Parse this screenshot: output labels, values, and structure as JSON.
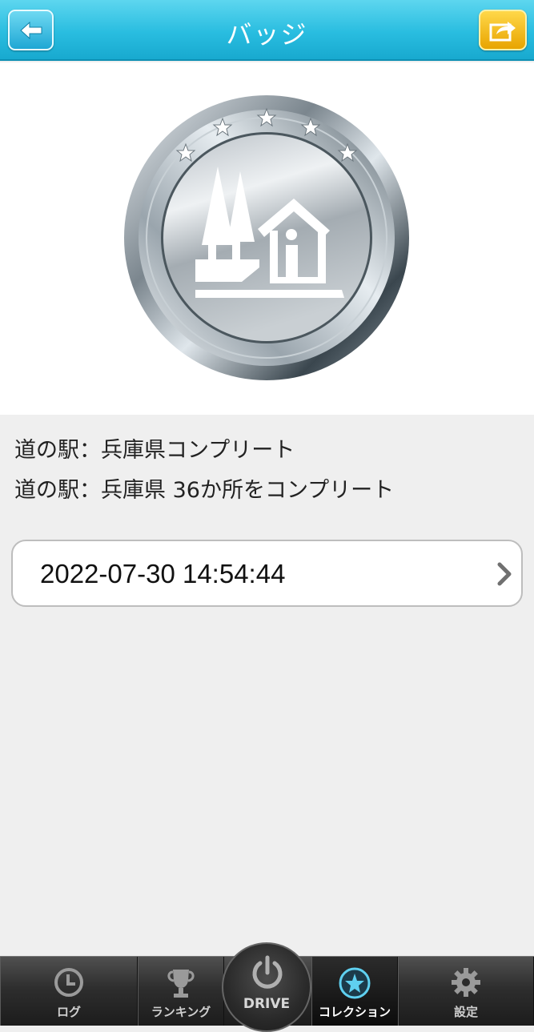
{
  "header": {
    "title": "バッジ",
    "back_icon": "arrow-left-icon",
    "share_icon": "share-export-icon"
  },
  "badge": {
    "icon": "roadside-station-badge-icon",
    "star_count": 5
  },
  "description": {
    "title": "道の駅：兵庫県コンプリート",
    "detail": "道の駅：兵庫県 36か所をコンプリート"
  },
  "record": {
    "datetime": "2022-07-30 14:54:44"
  },
  "tabbar": {
    "items": [
      {
        "label": "ログ",
        "icon": "clock-icon"
      },
      {
        "label": "ランキング",
        "icon": "trophy-icon"
      },
      {
        "label": "DRIVE",
        "icon": "power-icon"
      },
      {
        "label": "コレクション",
        "icon": "star-badge-icon",
        "active": true
      },
      {
        "label": "設定",
        "icon": "gear-icon"
      }
    ]
  },
  "colors": {
    "header": "#29bde0",
    "share_button": "#f2b800",
    "background": "#efefef"
  }
}
